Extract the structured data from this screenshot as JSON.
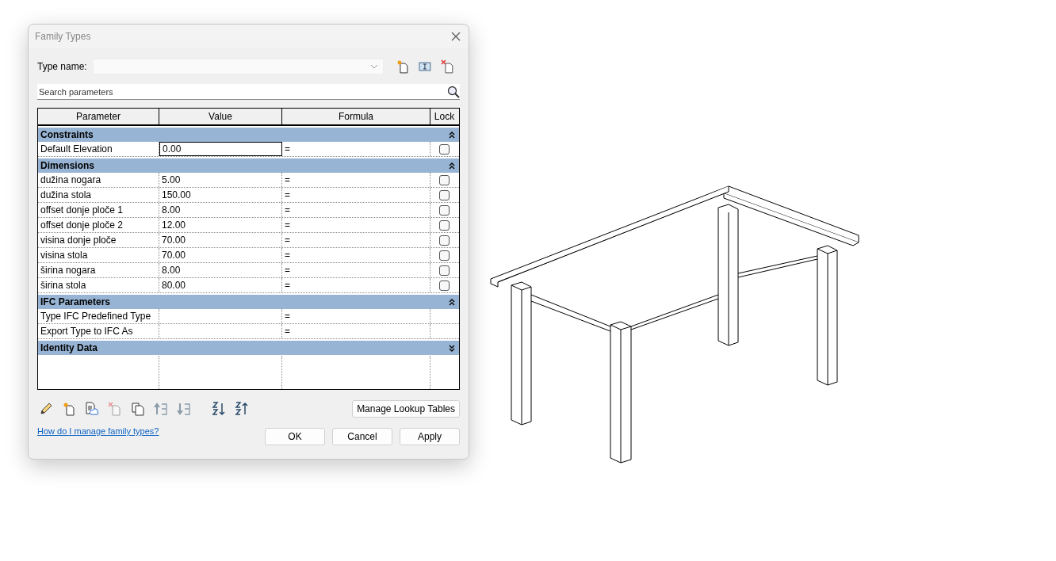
{
  "dialog": {
    "title": "Family Types",
    "type_name_label": "Type name:",
    "search": {
      "placeholder": "Search parameters"
    },
    "table": {
      "columns": [
        "Parameter",
        "Value",
        "Formula",
        "Lock"
      ],
      "groups": [
        {
          "name": "Constraints",
          "expanded": true,
          "rows": [
            {
              "kind": "lockable",
              "parameter": "Default Elevation",
              "value": "0.00",
              "formula": "=",
              "locked": false,
              "selected": true
            }
          ]
        },
        {
          "name": "Dimensions",
          "expanded": true,
          "rows": [
            {
              "kind": "lockable",
              "parameter": "dužina nogara",
              "value": "5.00",
              "formula": "=",
              "locked": false,
              "selected": false
            },
            {
              "kind": "lockable",
              "parameter": "dužina stola",
              "value": "150.00",
              "formula": "=",
              "locked": false,
              "selected": false
            },
            {
              "kind": "lockable",
              "parameter": "offset donje ploče 1",
              "value": "8.00",
              "formula": "=",
              "locked": false,
              "selected": false
            },
            {
              "kind": "lockable",
              "parameter": "offset donje ploče 2",
              "value": "12.00",
              "formula": "=",
              "locked": false,
              "selected": false
            },
            {
              "kind": "lockable",
              "parameter": "visina donje ploče",
              "value": "70.00",
              "formula": "=",
              "locked": false,
              "selected": false
            },
            {
              "kind": "lockable",
              "parameter": "visina stola",
              "value": "70.00",
              "formula": "=",
              "locked": false,
              "selected": false
            },
            {
              "kind": "lockable",
              "parameter": "širina nogara",
              "value": "8.00",
              "formula": "=",
              "locked": false,
              "selected": false
            },
            {
              "kind": "lockable",
              "parameter": "širina stola",
              "value": "80.00",
              "formula": "=",
              "locked": false,
              "selected": false
            }
          ]
        },
        {
          "name": "IFC Parameters",
          "expanded": true,
          "rows": [
            {
              "kind": "plain",
              "parameter": "Type IFC Predefined Type",
              "formula": "=",
              "selected": false
            },
            {
              "kind": "plain",
              "parameter": "Export Type to IFC As",
              "formula": "=",
              "selected": false
            }
          ]
        },
        {
          "name": "Identity Data",
          "expanded": false
        }
      ]
    },
    "manage_lookup_button": "Manage Lookup Tables",
    "help_link": "How do I manage family types?",
    "buttons": [
      "OK",
      "Cancel",
      "Apply"
    ]
  }
}
